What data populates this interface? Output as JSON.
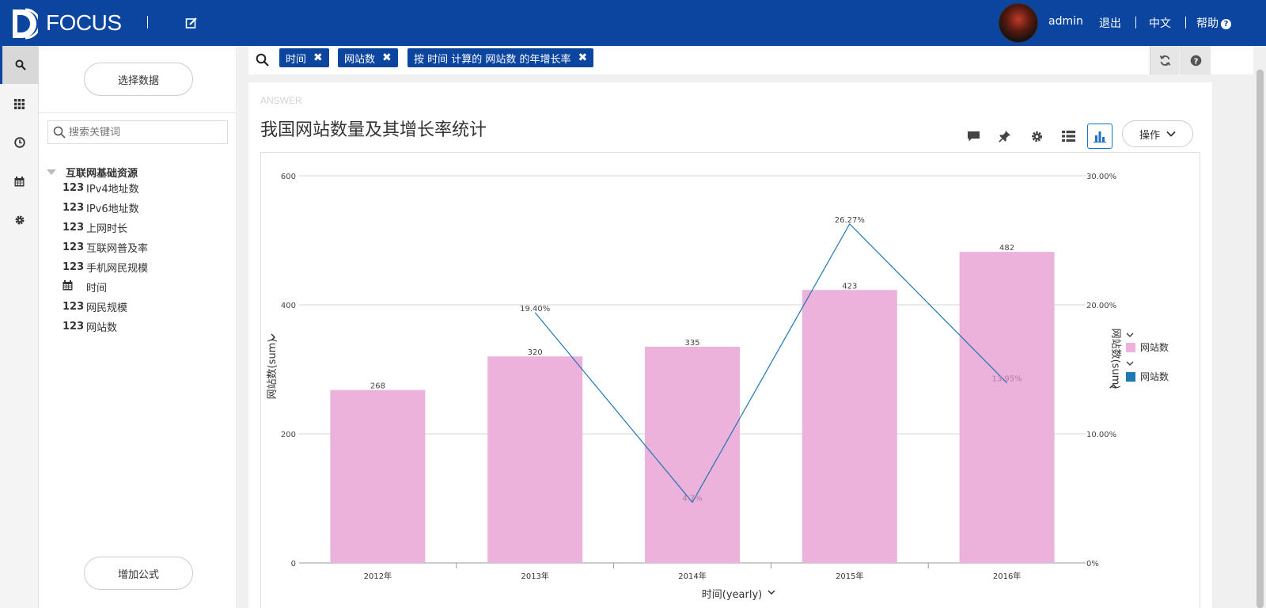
{
  "app": {
    "logo_text": "FOCUS"
  },
  "topbar": {
    "user": "admin",
    "logout": "退出",
    "language": "中文",
    "help": "帮助"
  },
  "datapanel": {
    "select_data_label": "选择数据",
    "search_placeholder": "搜索关键词",
    "group_name": "互联网基础资源",
    "fields": [
      {
        "type": "123",
        "name": "IPv4地址数"
      },
      {
        "type": "123",
        "name": "IPv6地址数"
      },
      {
        "type": "123",
        "name": "上网时长"
      },
      {
        "type": "123",
        "name": "互联网普及率"
      },
      {
        "type": "123",
        "name": "手机网民规模"
      },
      {
        "type": "calendar",
        "name": "时间"
      },
      {
        "type": "123",
        "name": "网民规模"
      },
      {
        "type": "123",
        "name": "网站数"
      }
    ],
    "add_formula_label": "增加公式"
  },
  "query": {
    "tags": [
      "时间",
      "网站数",
      "按 时间 计算的 网站数 的年增长率"
    ]
  },
  "answer": {
    "label": "ANSWER",
    "title": "我国网站数量及其增长率统计",
    "ops_label": "操作"
  },
  "chart_data": {
    "type": "bar",
    "categories": [
      "2012年",
      "2013年",
      "2014年",
      "2015年",
      "2016年"
    ],
    "series": [
      {
        "name": "网站数",
        "kind": "bar",
        "axis": "left",
        "color": "#ecb2dc",
        "values": [
          268,
          320,
          335,
          423,
          482
        ]
      },
      {
        "name": "网站数",
        "kind": "line",
        "axis": "right",
        "color": "#1f77b4",
        "values": [
          null,
          19.4,
          4.7,
          26.27,
          13.95
        ],
        "labels": [
          "",
          "19.40%",
          "4.7%",
          "26.27%",
          "13.95%"
        ]
      }
    ],
    "left_ticks": [
      "0",
      "200",
      "400",
      "600"
    ],
    "right_ticks": [
      "0%",
      "10.00%",
      "20.00%",
      "30.00%"
    ],
    "ylim": [
      0,
      600
    ],
    "y2lim": [
      0,
      30
    ],
    "xlabel": "时间(yearly)",
    "ylabel": "网站数(sum)",
    "y2label": "网站数(sum)",
    "legend": [
      "网站数",
      "网站数"
    ],
    "legend_position": "right",
    "grid": true
  }
}
